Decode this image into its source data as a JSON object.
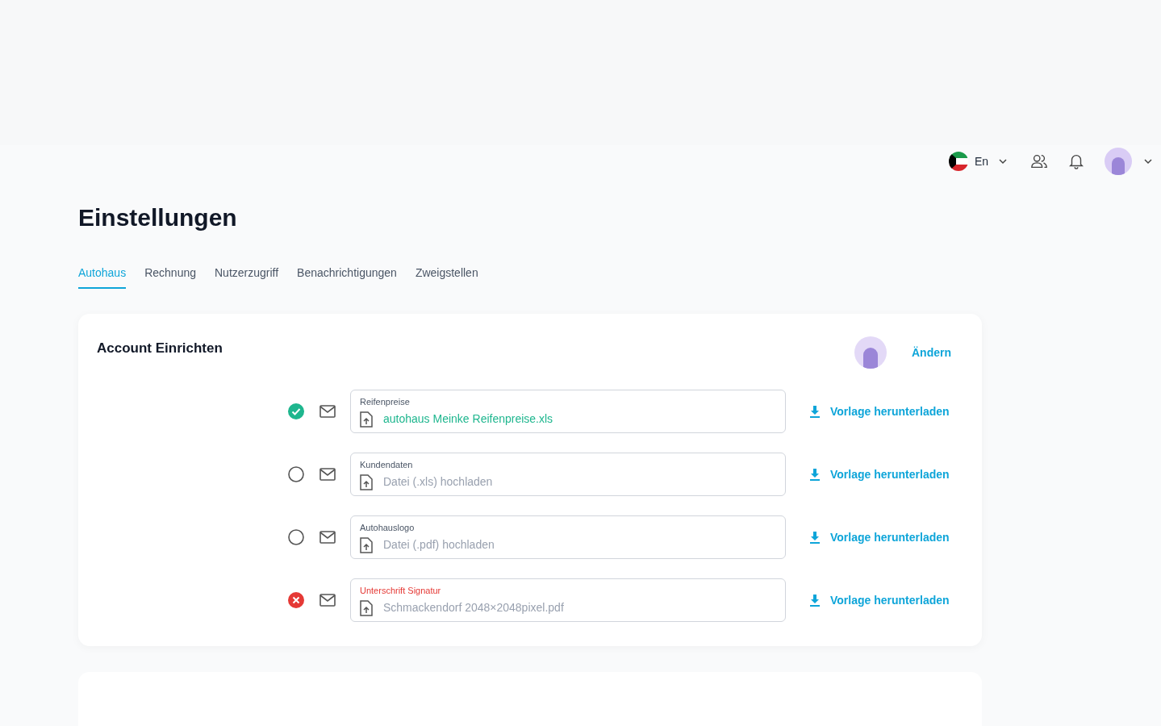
{
  "header": {
    "language": "En"
  },
  "title": "Einstellungen",
  "tabs": [
    {
      "label": "Autohaus",
      "selected": true
    },
    {
      "label": "Rechnung",
      "selected": false
    },
    {
      "label": "Nutzerzugriff",
      "selected": false
    },
    {
      "label": "Benachrichtigungen",
      "selected": false
    },
    {
      "label": "Zweigstellen",
      "selected": false
    }
  ],
  "card": {
    "title": "Account Einrichten",
    "change_link": "Ändern",
    "uploads": [
      {
        "kind": "done",
        "label": "Reifenpreise",
        "value": "autohaus Meinke Reifenpreise.xls",
        "download": "Vorlage herunterladen"
      },
      {
        "kind": "pending",
        "label": "Kundendaten",
        "placeholder": "Datei (.xls) hochladen",
        "download": "Vorlage herunterladen"
      },
      {
        "kind": "pending",
        "label": "Autohauslogo",
        "placeholder": "Datei (.pdf) hochladen",
        "download": "Vorlage herunterladen"
      },
      {
        "kind": "error",
        "label": "Unterschrift Signatur",
        "value": "Schmackendorf 2048×2048pixel.pdf",
        "download": "Vorlage herunterladen"
      }
    ]
  }
}
